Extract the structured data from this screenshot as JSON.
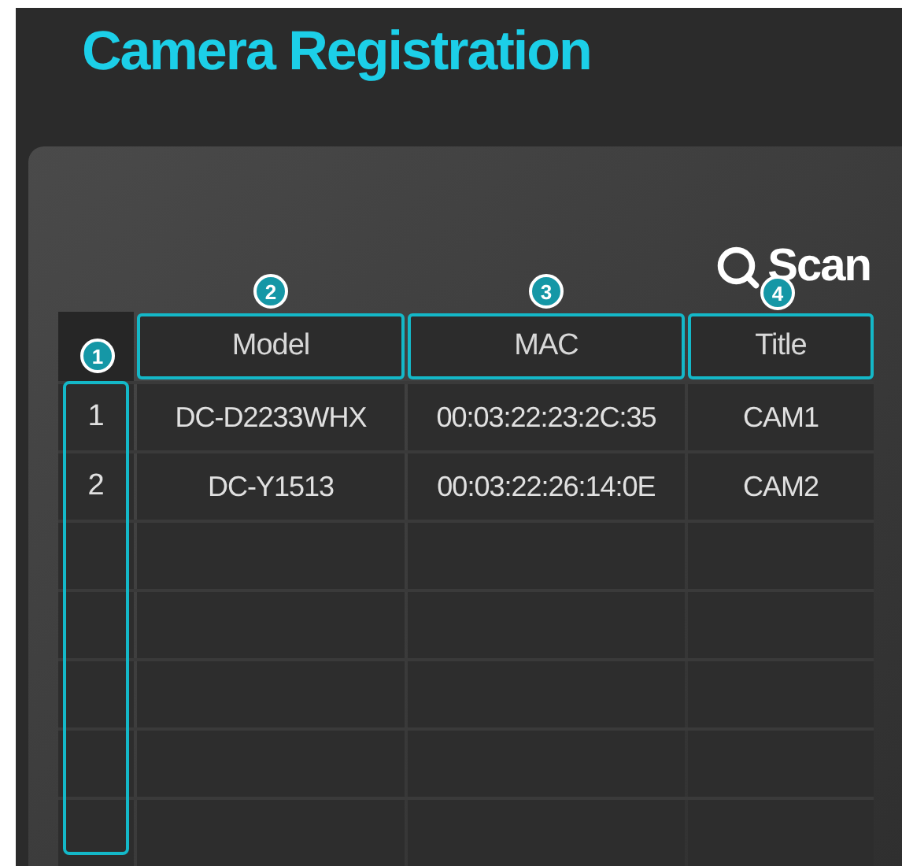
{
  "title": "Camera Registration",
  "scan_button": {
    "label": "Scan"
  },
  "table": {
    "index_column": {
      "highlighted": true
    },
    "columns": [
      {
        "label": "Model",
        "highlighted": true
      },
      {
        "label": "MAC",
        "highlighted": true
      },
      {
        "label": "Title",
        "highlighted": true
      }
    ],
    "rows": [
      {
        "index": "1",
        "cells": [
          "DC-D2233WHX",
          "00:03:22:23:2C:35",
          "CAM1"
        ]
      },
      {
        "index": "2",
        "cells": [
          "DC-Y1513",
          "00:03:22:26:14:0E",
          "CAM2"
        ]
      }
    ]
  },
  "callouts": [
    "1",
    "2",
    "3",
    "4"
  ]
}
